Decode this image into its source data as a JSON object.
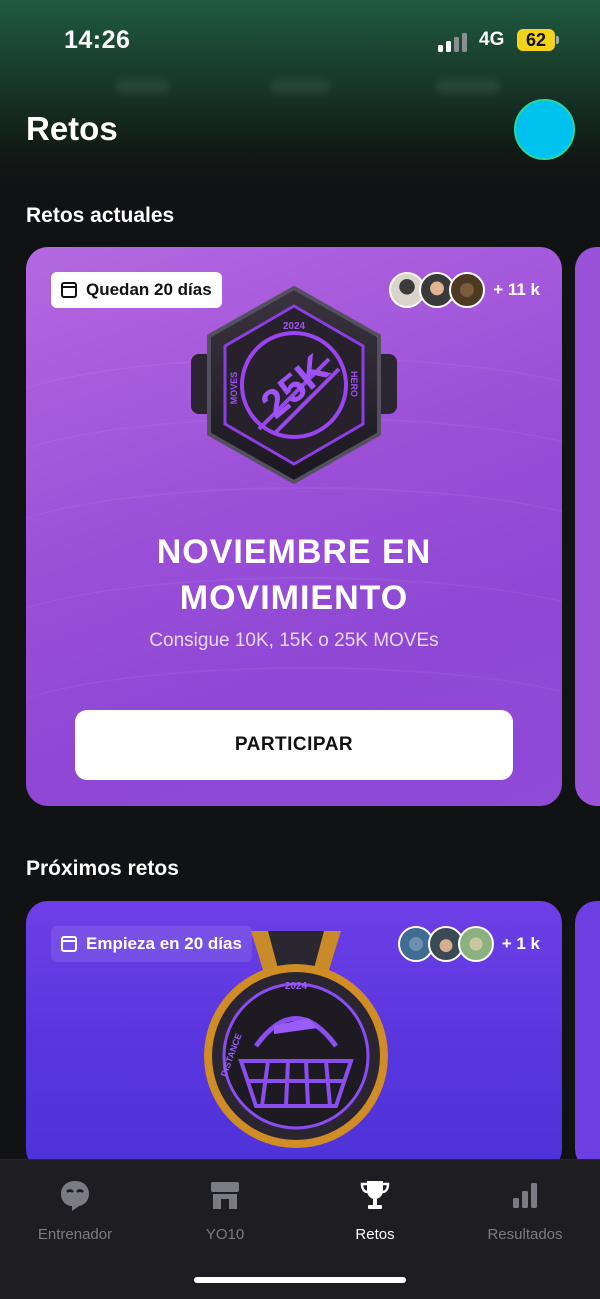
{
  "status_bar": {
    "time": "14:26",
    "network": "4G",
    "battery": "62"
  },
  "header": {
    "title": "Retos"
  },
  "current": {
    "section_title": "Retos actuales",
    "challenge": {
      "days_left": "Quedan 20 días",
      "participants_count": "+ 11 k",
      "badge": {
        "year": "2024",
        "value": "25K",
        "left_text": "MOVES",
        "right_text": "HERO"
      },
      "title_line1": "NOVIEMBRE EN",
      "title_line2": "MOVIMIENTO",
      "subtitle": "Consigue 10K, 15K o 25K MOVEs",
      "cta_label": "PARTICIPAR"
    }
  },
  "upcoming": {
    "section_title": "Próximos retos",
    "challenge": {
      "starts_in": "Empieza en 20 días",
      "participants_count": "+ 1 k",
      "medal": {
        "year": "2024",
        "side_text": "DISTANCE"
      }
    }
  },
  "bottom_nav": {
    "items": [
      {
        "label": "Entrenador",
        "icon": "coach-chat-icon"
      },
      {
        "label": "YO10",
        "icon": "store-icon"
      },
      {
        "label": "Retos",
        "icon": "trophy-icon",
        "active": true
      },
      {
        "label": "Resultados",
        "icon": "bar-chart-icon"
      }
    ]
  },
  "colors": {
    "accent": "#00c2ee",
    "card_current": "#9b4fd8",
    "card_next": "#5a36de"
  }
}
